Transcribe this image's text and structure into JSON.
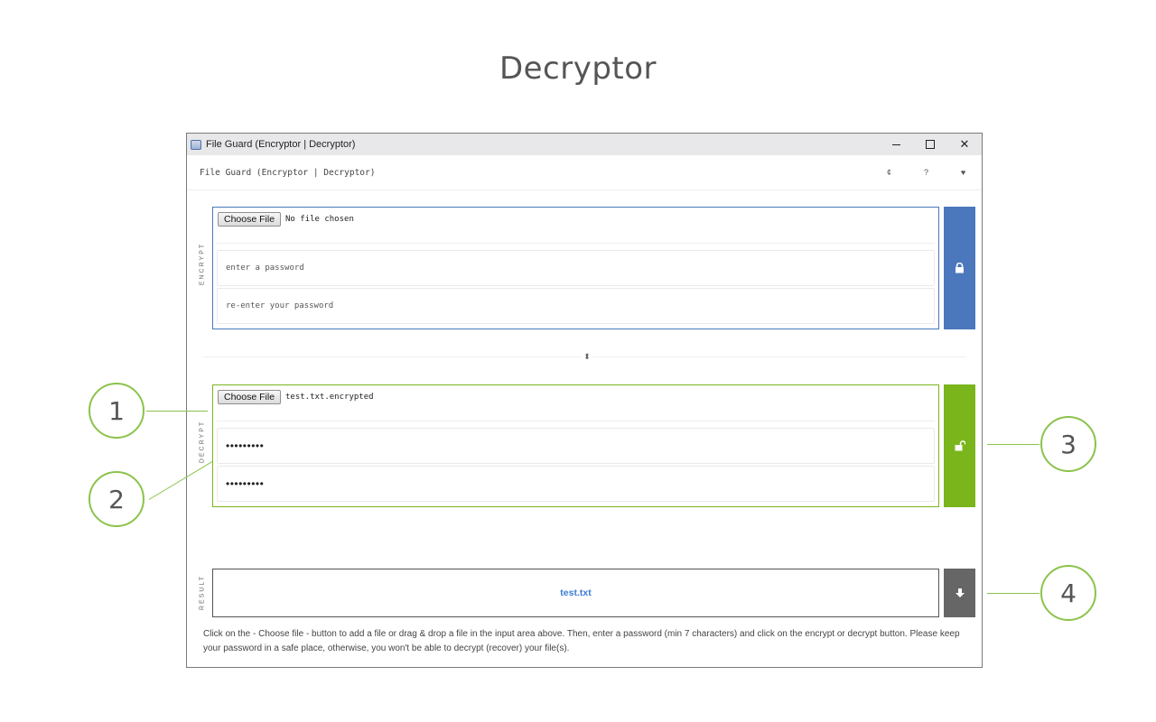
{
  "page": {
    "title": "Decryptor"
  },
  "window": {
    "title": "File Guard (Encryptor | Decryptor)",
    "controls": {
      "minimize": "–",
      "maximize": "",
      "close": "✕"
    }
  },
  "toolbar": {
    "title": "File Guard (Encryptor | Decryptor)",
    "icons": [
      "reload-icon",
      "help-icon",
      "heart-icon"
    ],
    "reload_glyph": "¢",
    "help_glyph": "?",
    "heart_glyph": "♥"
  },
  "encrypt": {
    "label": "ENCRYPT",
    "file_button": "Choose File",
    "file_name": "No file chosen",
    "password_placeholder": "enter a password",
    "password_confirm_placeholder": "re-enter your password",
    "button_icon": "lock-icon",
    "color": "#4b77bd"
  },
  "decrypt": {
    "label": "DECRYPT",
    "file_button": "Choose File",
    "file_name": "test.txt.encrypted",
    "password_value": "•••••••••",
    "password_confirm_value": "•••••••••",
    "button_icon": "unlock-icon",
    "color": "#7ab51c"
  },
  "result": {
    "label": "RESULT",
    "file": "test.txt",
    "button_icon": "download-icon"
  },
  "help_text": "Click on the - Choose file - button to add a file or drag & drop a file in the input area above. Then, enter a password (min 7 characters) and click on the encrypt or decrypt button. Please keep your password in a safe place, otherwise, you won't be able to decrypt (recover) your file(s).",
  "callouts": [
    "1",
    "2",
    "3",
    "4"
  ],
  "callout_color": "#8bc34a"
}
